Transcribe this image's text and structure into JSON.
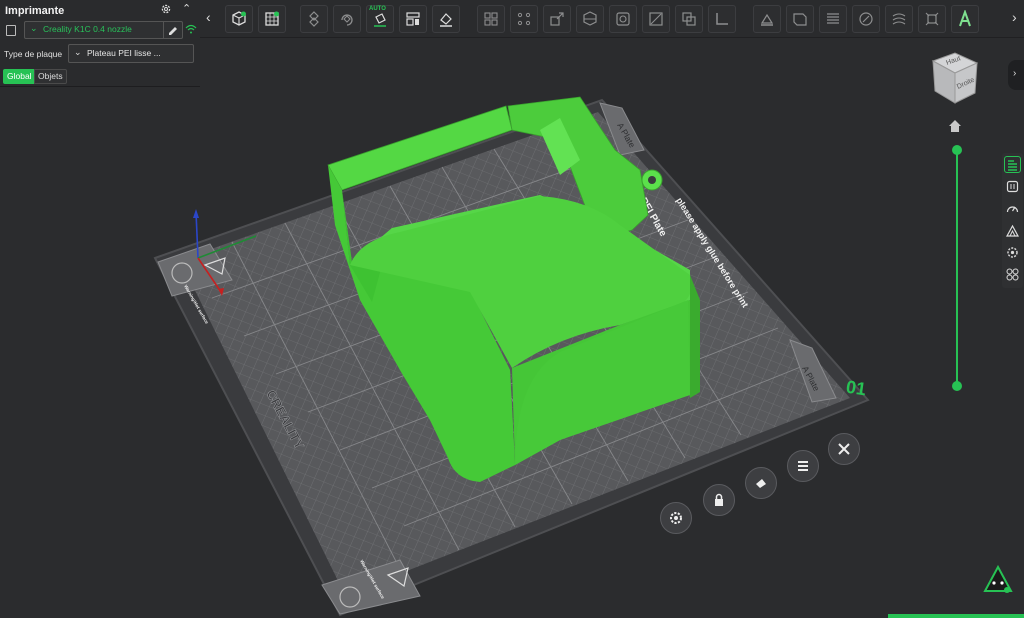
{
  "left_panel": {
    "title": "Imprimante",
    "printer": "Creality K1C 0.4 nozzle",
    "plate_type_label": "Type de plaque",
    "plate_type_value": "Plateau PEI lisse ...",
    "segments": [
      "Global",
      "Objets"
    ]
  },
  "toolbar": {
    "auto_label": "AUTO",
    "buttons": [
      "add-cube",
      "plate-grid",
      "move",
      "rotate",
      "auto-orient",
      "arrange",
      "layer-paint",
      "split-objects",
      "split-parts",
      "scale",
      "cut",
      "boolean",
      "support",
      "seam",
      "fuzzy",
      "measure",
      "emboss",
      "lay-flat",
      "text-shape",
      "variable-layer",
      "brim",
      "assembly",
      "text"
    ]
  },
  "viewport": {
    "plate_number": "01",
    "plate_labels": [
      "A Plate",
      "A Plate"
    ],
    "plate_brand": "CREALITY",
    "plate_material": "PEI Plate",
    "plate_warning": "please apply glue before print",
    "plate_hot": "Warning!Hot surface",
    "cube_faces": [
      "Haut",
      "Droite"
    ]
  },
  "colors": {
    "accent": "#27c254",
    "model": "#47d43a",
    "background": "#2b2c2e",
    "panel": "#2a2b2d"
  },
  "plate_buttons": [
    "settings",
    "lock",
    "auto-arrange",
    "orient",
    "close"
  ]
}
